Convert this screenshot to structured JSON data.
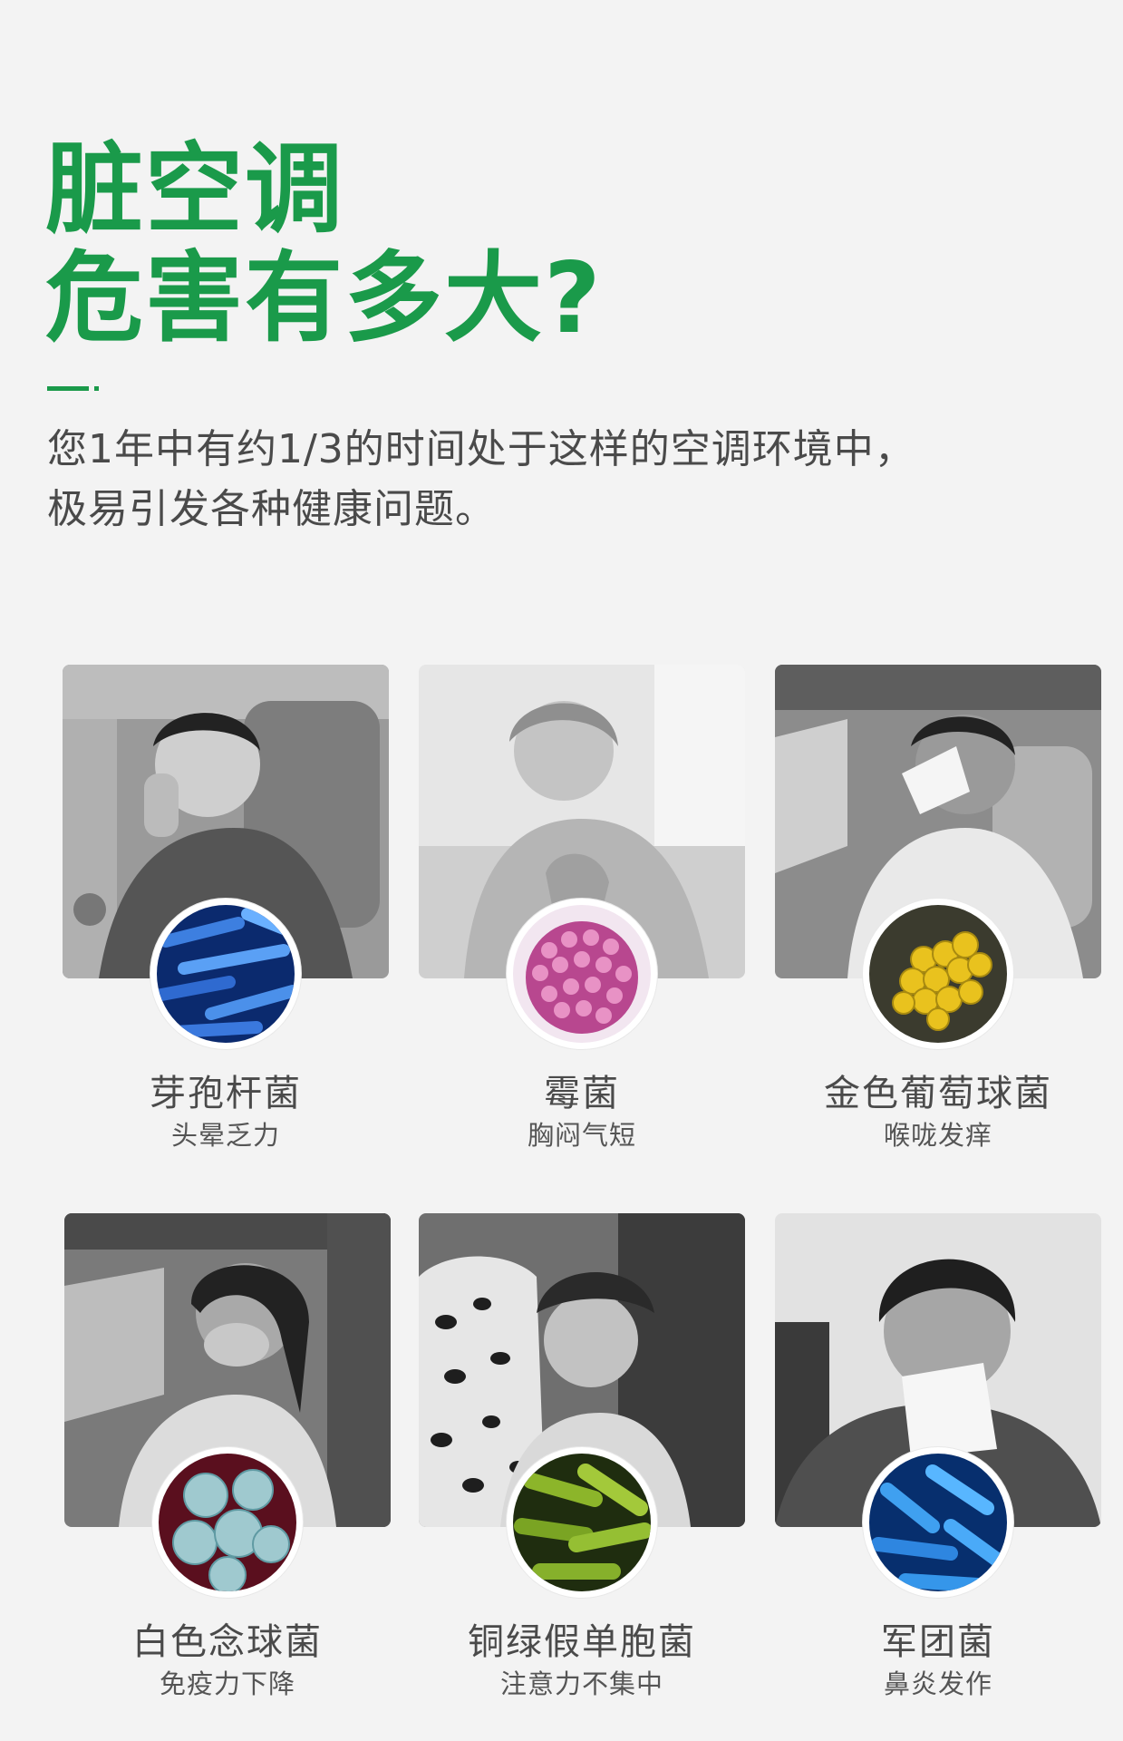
{
  "headline": {
    "line1": "脏空调",
    "line2": "危害有多大?"
  },
  "intro": {
    "line1": "您1年中有约1/3的时间处于这样的空调环境中，",
    "line2": "极易引发各种健康问题。"
  },
  "accent_color": "#1a9a4a",
  "cards": [
    {
      "name": "芽孢杆菌",
      "symptom": "头晕乏力",
      "photo": "child-sleeping-in-car-photo",
      "microbe": "rod-bacteria-blue-icon"
    },
    {
      "name": "霉菌",
      "symptom": "胸闷气短",
      "photo": "woman-chest-discomfort-photo",
      "microbe": "mold-spores-pink-icon"
    },
    {
      "name": "金色葡萄球菌",
      "symptom": "喉咙发痒",
      "photo": "man-sneezing-in-car-photo",
      "microbe": "cocci-cluster-yellow-icon"
    },
    {
      "name": "白色念球菌",
      "symptom": "免疫力下降",
      "photo": "woman-covering-mouth-in-car-photo",
      "microbe": "round-cells-teal-icon"
    },
    {
      "name": "铜绿假单胞菌",
      "symptom": "注意力不集中",
      "photo": "toddler-car-seat-photo",
      "microbe": "rod-bacteria-green-icon"
    },
    {
      "name": "军团菌",
      "symptom": "鼻炎发作",
      "photo": "man-blowing-nose-photo",
      "microbe": "rod-bacteria-blue-icon"
    }
  ]
}
